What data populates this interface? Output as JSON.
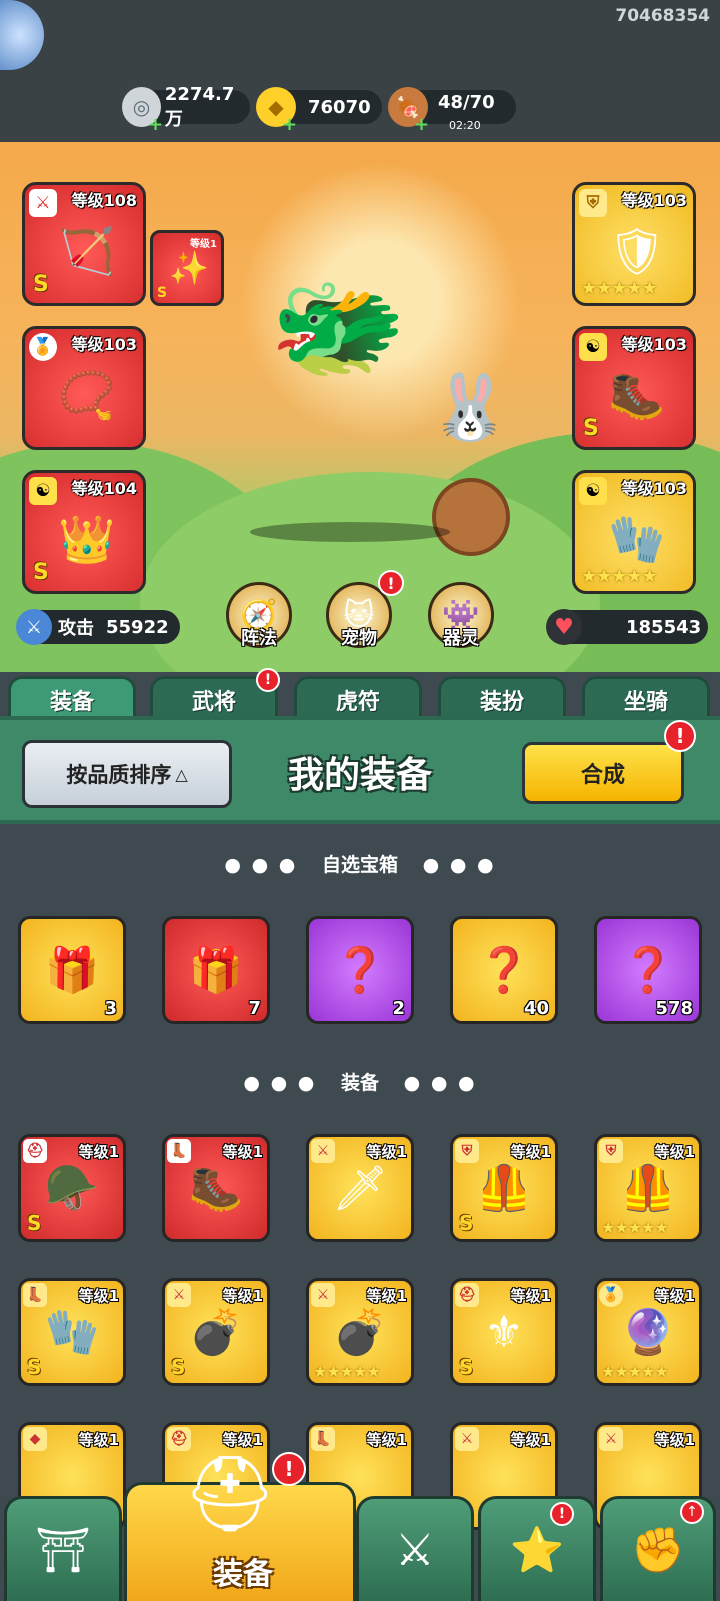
{
  "header": {
    "player_id": "70468354",
    "resources": [
      {
        "icon": "silver-coin-icon",
        "value": "2274.7万"
      },
      {
        "icon": "gold-ingot-icon",
        "value": "76070"
      },
      {
        "icon": "meat-stamina-icon",
        "value": "48/70",
        "timer": "02:20"
      }
    ]
  },
  "hero": {
    "equipped": [
      {
        "slot": "weapon",
        "level": "等级108",
        "grade": "S",
        "bg": "red"
      },
      {
        "slot": "accessory",
        "level": "等级1",
        "grade": "S",
        "bg": "red"
      },
      {
        "slot": "necklace",
        "level": "等级103",
        "grade": "",
        "bg": "red"
      },
      {
        "slot": "helmet",
        "level": "等级104",
        "grade": "S",
        "bg": "red"
      },
      {
        "slot": "armor",
        "level": "等级103",
        "grade": "",
        "bg": "gold"
      },
      {
        "slot": "boots",
        "level": "等级103",
        "grade": "S",
        "bg": "red"
      },
      {
        "slot": "gloves",
        "level": "等级103",
        "grade": "",
        "bg": "gold"
      }
    ],
    "attack_label": "攻击",
    "attack_value": "55922",
    "hp_value": "185543",
    "features": [
      {
        "label": "阵法",
        "icon": "formation-icon"
      },
      {
        "label": "宠物",
        "icon": "pet-cat-icon"
      },
      {
        "label": "器灵",
        "icon": "artifact-spirit-icon"
      }
    ]
  },
  "tabs": [
    "装备",
    "武将",
    "虎符",
    "装扮",
    "坐骑"
  ],
  "panel": {
    "sort_label": "按品质排序",
    "title": "我的装备",
    "merge_label": "合成"
  },
  "chests_section": {
    "title": "自选宝箱",
    "items": [
      {
        "bg": "gold",
        "count": "3"
      },
      {
        "bg": "red",
        "count": "7"
      },
      {
        "bg": "purple",
        "count": "2"
      },
      {
        "bg": "gold",
        "count": "40"
      },
      {
        "bg": "purple",
        "count": "578"
      }
    ]
  },
  "equip_section": {
    "title": "装备",
    "level": "等级1",
    "grade": "S"
  },
  "bottom_nav": {
    "active_label": "装备"
  },
  "colors": {
    "accent_green": "#3e8a68",
    "button_yellow": "#f5b400",
    "quality_red": "#d42a2b",
    "quality_gold": "#f0b820",
    "quality_purple": "#9a35d6"
  }
}
